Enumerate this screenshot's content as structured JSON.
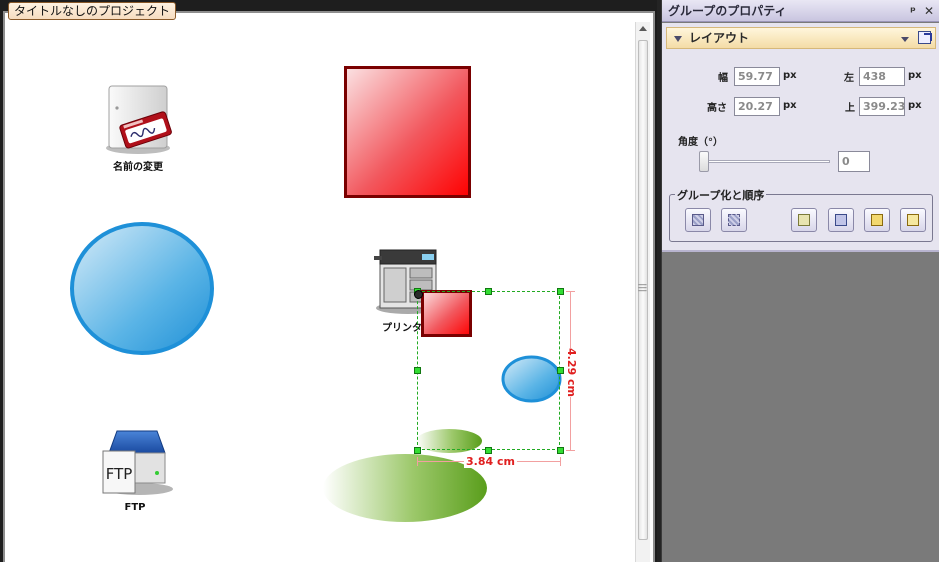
{
  "document": {
    "tab_title": "タイトルなしのプロジェクト"
  },
  "canvas": {
    "labels": {
      "rename": "名前の変更",
      "printer": "プリンター",
      "ftp": "FTP"
    },
    "dimensions": {
      "height": "4.29 cm",
      "width": "3.84 cm"
    },
    "colors": {
      "red_shape": "#e8202a",
      "red_border": "#7a0000",
      "blue_shape": "#2a9ad8",
      "blue_border": "#1e90d8",
      "green_shape": "#5aa020",
      "selection": "#22aa22",
      "dimension": "#e02020"
    }
  },
  "panel": {
    "title": "グループのプロパティ",
    "pin_icon": "pin-icon",
    "close_icon": "close-icon",
    "section_title": "レイアウト",
    "width_label": "幅",
    "width_value": "59.77",
    "left_label": "左",
    "left_value": "438",
    "height_label": "高さ",
    "height_value": "20.27",
    "top_label": "上",
    "top_value": "399.23",
    "unit": "px",
    "angle_label": "角度（°）",
    "angle_value": "0",
    "angle_slider_fraction": 0,
    "group_title": "グループ化と順序",
    "buttons": [
      "group-icon",
      "ungroup-icon",
      "bring-to-front-icon",
      "bring-forward-icon",
      "send-backward-icon",
      "send-to-back-icon"
    ]
  }
}
